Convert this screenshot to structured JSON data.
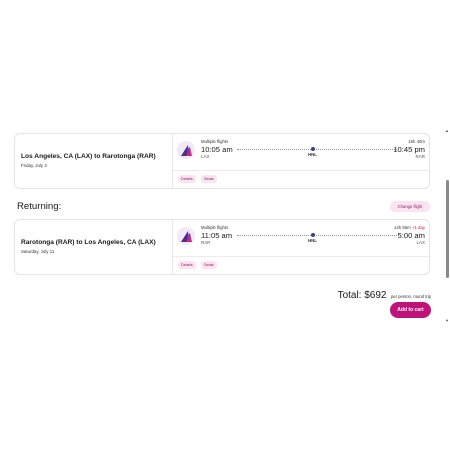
{
  "outbound": {
    "route": "Los Angeles, CA (LAX) to Rarotonga (RAR)",
    "date": "Friday, July 3",
    "multiple_flights": "Multiple flights",
    "depart_time": "10:05 am",
    "depart_code": "LAX",
    "stop_code": "HNL",
    "duration": "15h 40m",
    "arrive_time": "10:45 pm",
    "arrive_code": "RAR",
    "details_label": "Details",
    "seats_label": "Seats"
  },
  "returning": {
    "section_title": "Returning:",
    "change_flight_label": "Change flight",
    "route": "Rarotonga (RAR) to Los Angeles, CA (LAX)",
    "date": "Saturday, July 11",
    "multiple_flights": "Multiple flights",
    "depart_time": "11:05 am",
    "depart_code": "RAR",
    "stop_code": "HNL",
    "duration": "14h 55m",
    "plus_day": "+1 day",
    "arrive_time": "5:00 am",
    "arrive_code": "LAX",
    "details_label": "Details",
    "seats_label": "Seats"
  },
  "summary": {
    "total_label": "Total: $692",
    "per_person": "per person, round trip",
    "add_to_cart_label": "Add to cart"
  },
  "icons": {
    "airline_logo": "airline-logo-icon",
    "scroll_up": "scroll-up-icon",
    "scroll_down": "scroll-down-icon"
  },
  "colors": {
    "accent": "#c0137a",
    "pill_bg": "#fbe3f0",
    "pill_text": "#8e1f63",
    "stop_dot": "#3b3b9a"
  }
}
